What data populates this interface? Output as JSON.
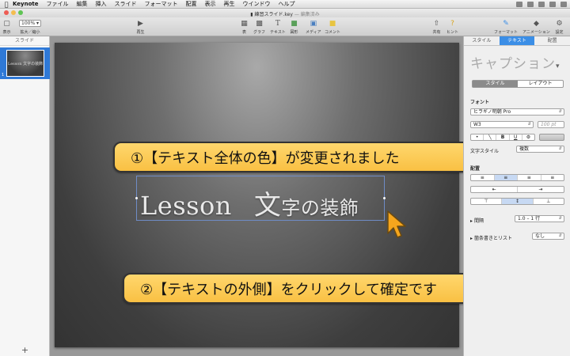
{
  "menubar": {
    "app_name": "Keynote",
    "items": [
      "ファイル",
      "編集",
      "挿入",
      "スライド",
      "フォーマット",
      "配置",
      "表示",
      "再生",
      "ウインドウ",
      "ヘルプ"
    ]
  },
  "window": {
    "title": "練習スライド.key",
    "status": "— 編集済み"
  },
  "toolbar": {
    "view_label": "表示",
    "zoom_value": "100%",
    "zoom_label": "拡大／縮小",
    "play_label": "再生",
    "table_label": "表",
    "chart_label": "グラフ",
    "text_label": "テキスト",
    "shape_label": "図形",
    "media_label": "メディア",
    "comment_label": "コメント",
    "share_label": "共有",
    "tips_label": "ヒント",
    "format_label": "フォーマット",
    "animate_label": "アニメーション",
    "setup_label": "設定"
  },
  "navigator": {
    "header": "スライド",
    "slide_number": "1",
    "thumb_text": "Lesson 文字の装飾",
    "add_label": "+"
  },
  "slide": {
    "text_latin": "Lesson",
    "text_jp_big": "文",
    "text_jp_rest": "字の装飾"
  },
  "callouts": {
    "first": "①【テキスト全体の色】が変更されました",
    "second": "②【テキストの外側】をクリックして確定です"
  },
  "inspector": {
    "tabs": [
      "スタイル",
      "テキスト",
      "配置"
    ],
    "active_tab": "テキスト",
    "paragraph_style": "キャプション",
    "segment": [
      "スタイル",
      "レイアウト"
    ],
    "font_section": "フォント",
    "font_family": "ヒラギノ明朝 Pro",
    "font_weight": "W3",
    "font_size": "100 pt",
    "char_style_label": "文字スタイル",
    "char_style_value": "複数",
    "align_section": "配置",
    "spacing_label": "間隔",
    "spacing_value": "1.0 – 1 行",
    "bullets_label": "箇条書きとリスト",
    "bullets_value": "なし"
  },
  "colors": {
    "accent": "#3b8ee6",
    "callout_fill": "#f9c043"
  }
}
